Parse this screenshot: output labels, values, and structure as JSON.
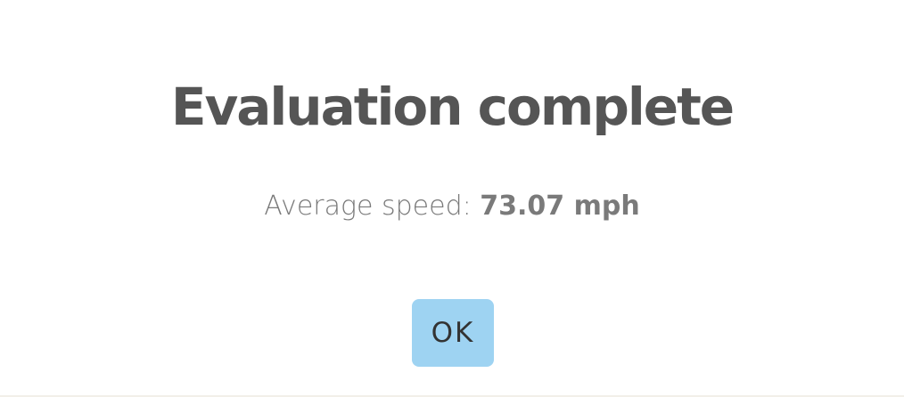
{
  "dialog": {
    "title": "Evaluation complete",
    "result_label": "Average speed:",
    "result_value": "73.07 mph",
    "ok_label": "OK"
  },
  "colors": {
    "title_text": "#555555",
    "body_text": "#7a7a7a",
    "button_background": "#9ed3f2",
    "button_text": "#333333",
    "background": "#ffffff"
  }
}
